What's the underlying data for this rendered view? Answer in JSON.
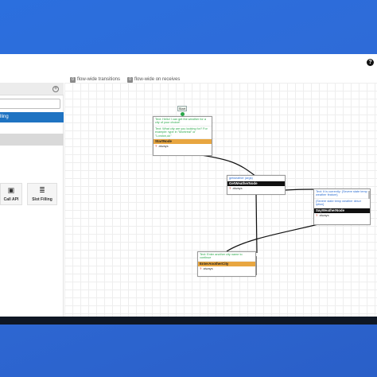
{
  "app": {
    "help_icon": "?"
  },
  "colors": {
    "background": "#2f6ad6",
    "accent": "#1f73c2",
    "node_title_dark": "#111111",
    "node_title_orange": "#e8a640",
    "green_text": "#2aa84a",
    "blue_text": "#2f6fd1"
  },
  "sidebar": {
    "add_icon": "+",
    "active_item": "lling",
    "tools": [
      {
        "icon": "camera-icon",
        "glyph": "▣",
        "label": "Call API"
      },
      {
        "icon": "bars-icon",
        "glyph": "≣",
        "label": "Slot Filling"
      }
    ]
  },
  "counters": [
    {
      "count": "0",
      "label": "flow-wide transitions"
    },
    {
      "count": "0",
      "label": "flow-wide on receives"
    }
  ],
  "start_label": "Start",
  "nodes": {
    "start": {
      "text1": "Text: Hello! I can get the weather for a city of your choice!",
      "text2": "Text: What city are you looking for? For example: type in \"Montreal\" or \"London,uk\"",
      "title": "StartNode",
      "transition": "always"
    },
    "get_weather": {
      "text1": "getweather (args)",
      "title": "GetWeatherNode",
      "transition": "always"
    },
    "say_weather": {
      "text1": "Text: It is currently: {Severe state temp weather feature}",
      "text2": "{Severe state temp weather descr iption}",
      "title": "SayWeatherNode",
      "transition": "always"
    },
    "enter_another": {
      "text1": "Text: Enter another city name to continue",
      "title": "EnterAnotherCity",
      "transition": "always"
    }
  }
}
